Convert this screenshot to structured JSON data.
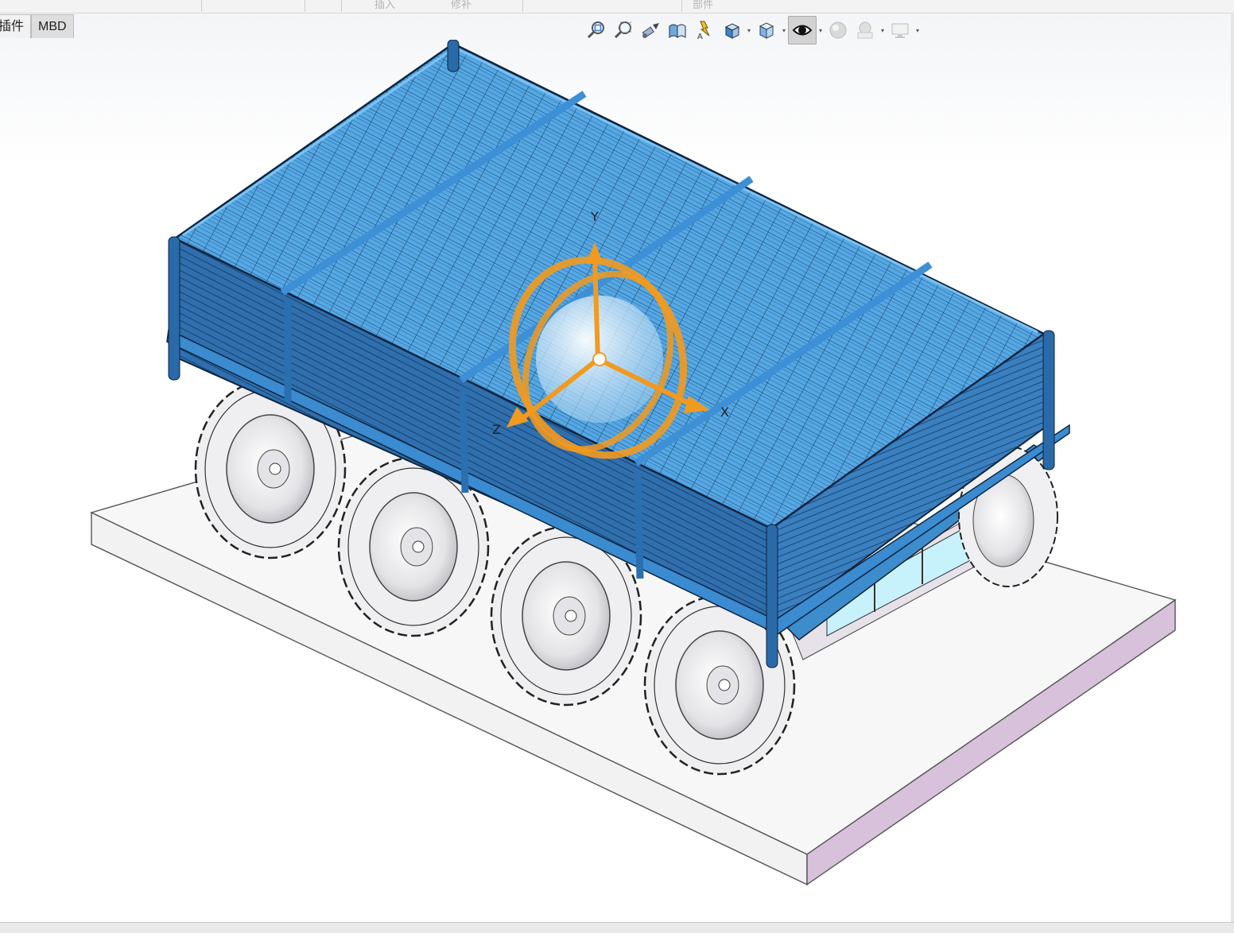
{
  "top_toolbar": {
    "segments": [
      "",
      "",
      "",
      "",
      "插入",
      "修补",
      "",
      "",
      "",
      "部件"
    ]
  },
  "tabs": [
    {
      "label": "插件"
    },
    {
      "label": "MBD"
    }
  ],
  "heads_up_toolbar": {
    "icons": [
      "zoom-to-fit-icon",
      "zoom-to-area-icon",
      "previous-view-icon",
      "section-view-icon",
      "dynamic-annotation-icon",
      "view-orientation-icon",
      "display-style-icon",
      "hide-show-items-icon",
      "edit-appearance-icon",
      "apply-scene-icon",
      "view-settings-icon"
    ],
    "pressed": "hide-show-items-icon"
  },
  "triad": {
    "x_label": "X",
    "y_label": "Y",
    "z_label": "Z"
  },
  "colors": {
    "panel_blue": "#4a9fdc",
    "frame_dark": "#2e6aa6",
    "triad_orange": "#f29a1f",
    "wheel_gray": "#e8e8ea",
    "base_plate": "#f4f4f4",
    "base_side": "#d9c3db"
  }
}
